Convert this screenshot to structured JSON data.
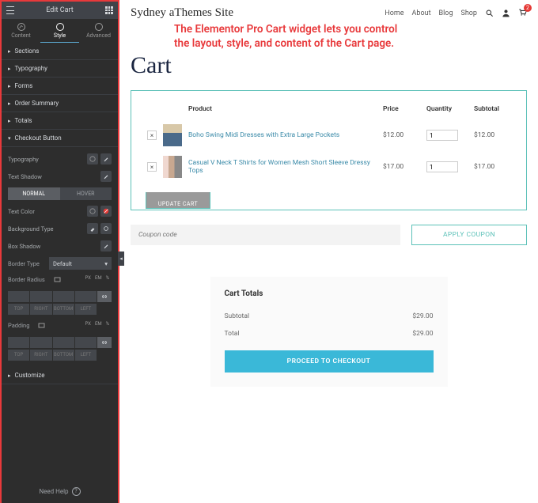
{
  "sidebar": {
    "title": "Edit Cart",
    "tabs": {
      "content": "Content",
      "style": "Style",
      "advanced": "Advanced"
    },
    "sections": {
      "sections": "Sections",
      "typography": "Typography",
      "forms": "Forms",
      "orderSummary": "Order Summary",
      "totals": "Totals",
      "checkoutButton": "Checkout Button",
      "customize": "Customize"
    },
    "controls": {
      "typography": "Typography",
      "textShadow": "Text Shadow",
      "normal": "NORMAL",
      "hover": "HOVER",
      "textColor": "Text Color",
      "bgType": "Background Type",
      "boxShadow": "Box Shadow",
      "borderType": "Border Type",
      "borderTypeVal": "Default",
      "borderRadius": "Border Radius",
      "padding": "Padding",
      "dims": {
        "top": "TOP",
        "right": "RIGHT",
        "bottom": "BOTTOM",
        "left": "LEFT"
      },
      "pxUnit": "PX",
      "emUnit": "EM",
      "pctUnit": "%"
    },
    "footer": "Need Help"
  },
  "header": {
    "logo": "Sydney aThemes Site",
    "nav": {
      "home": "Home",
      "about": "About",
      "blog": "Blog",
      "shop": "Shop"
    },
    "cartCount": "2"
  },
  "banner": {
    "line1": "The Elementor Pro Cart widget lets you control",
    "line2": "the layout, style, and content of the Cart page."
  },
  "page": {
    "title": "Cart"
  },
  "table": {
    "cols": {
      "product": "Product",
      "price": "Price",
      "qty": "Quantity",
      "subtotal": "Subtotal"
    },
    "rows": [
      {
        "name": "Boho Swing Midi Dresses with Extra Large Pockets",
        "price": "$12.00",
        "qty": "1",
        "subtotal": "$12.00"
      },
      {
        "name": "Casual V Neck T Shirts for Women Mesh Short Sleeve Dressy Tops",
        "price": "$17.00",
        "qty": "1",
        "subtotal": "$17.00"
      }
    ],
    "update": "UPDATE CART"
  },
  "coupon": {
    "placeholder": "Coupon code",
    "apply": "APPLY COUPON"
  },
  "totals": {
    "title": "Cart Totals",
    "subtotalLbl": "Subtotal",
    "subtotal": "$29.00",
    "totalLbl": "Total",
    "total": "$29.00",
    "checkout": "PROCEED TO CHECKOUT"
  }
}
